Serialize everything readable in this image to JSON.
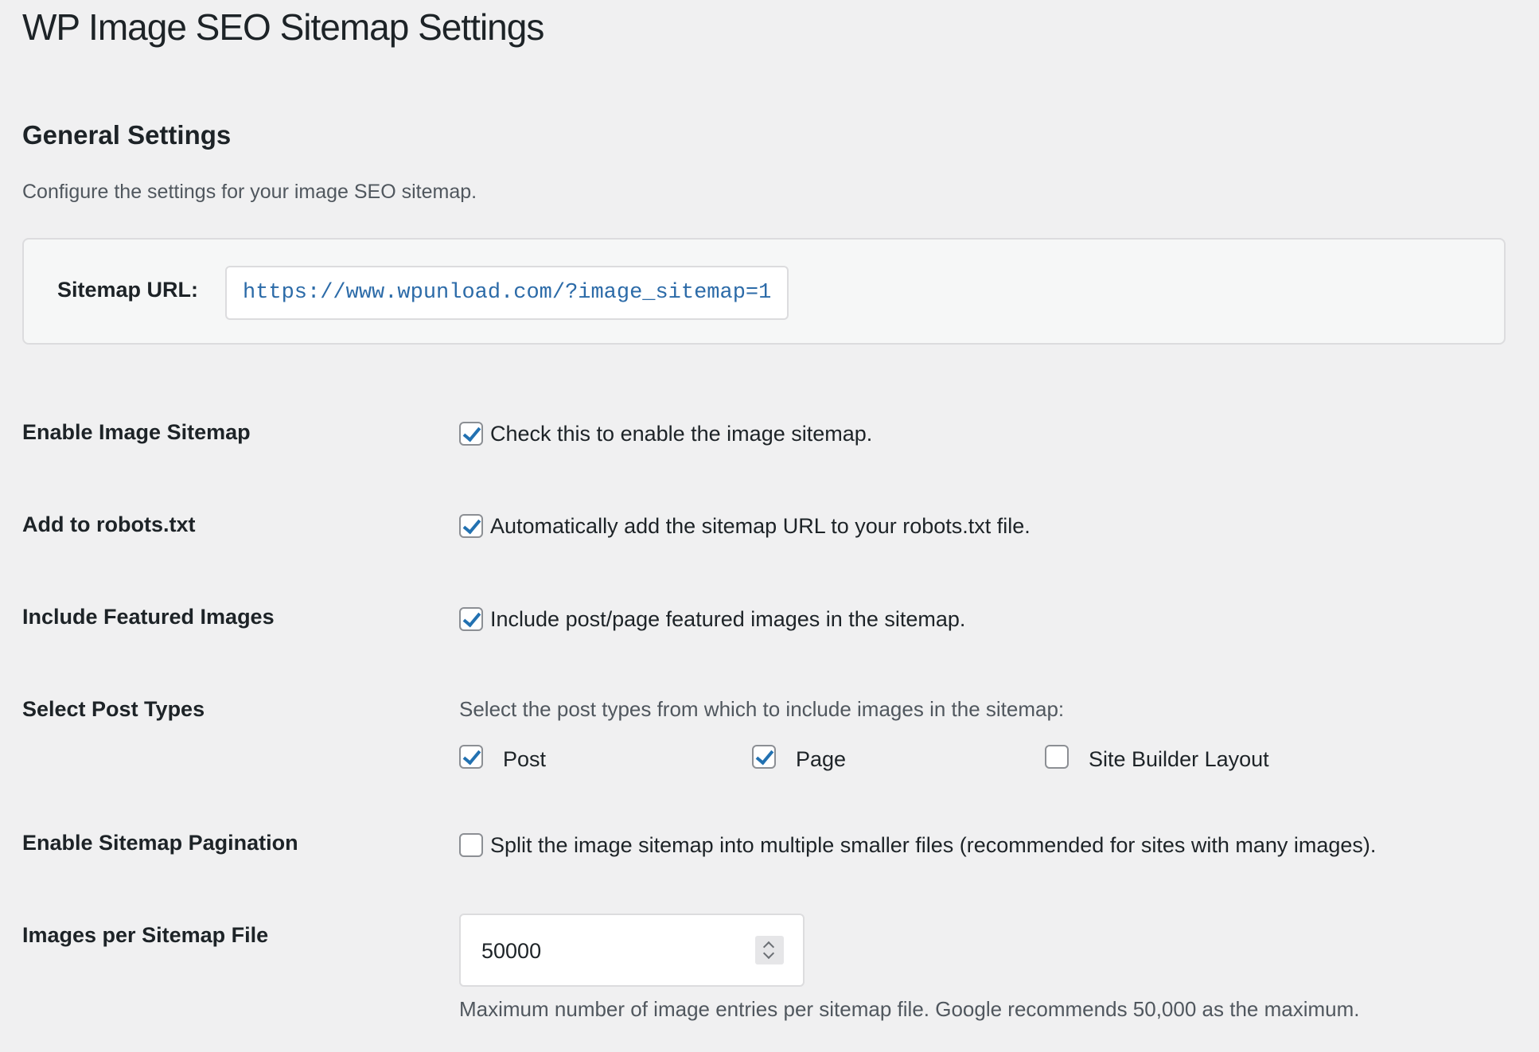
{
  "page": {
    "title": "WP Image SEO Sitemap Settings"
  },
  "section": {
    "title": "General Settings",
    "description": "Configure the settings for your image SEO sitemap."
  },
  "sitemap_url": {
    "label": "Sitemap URL:",
    "value": "https://www.wpunload.com/?image_sitemap=1"
  },
  "settings": {
    "enable_sitemap": {
      "label": "Enable Image Sitemap",
      "checked": true,
      "description": "Check this to enable the image sitemap."
    },
    "robots": {
      "label": "Add to robots.txt",
      "checked": true,
      "description": "Automatically add the sitemap URL to your robots.txt file."
    },
    "featured": {
      "label": "Include Featured Images",
      "checked": true,
      "description": "Include post/page featured images in the sitemap."
    },
    "post_types": {
      "label": "Select Post Types",
      "description": "Select the post types from which to include images in the sitemap:",
      "options": [
        {
          "label": "Post",
          "checked": true
        },
        {
          "label": "Page",
          "checked": true
        },
        {
          "label": "Site Builder Layout",
          "checked": false
        }
      ]
    },
    "pagination": {
      "label": "Enable Sitemap Pagination",
      "checked": false,
      "description": "Split the image sitemap into multiple smaller files (recommended for sites with many images)."
    },
    "per_file": {
      "label": "Images per Sitemap File",
      "value": "50000",
      "help": "Maximum number of image entries per sitemap file. Google recommends 50,000 as the maximum."
    }
  }
}
